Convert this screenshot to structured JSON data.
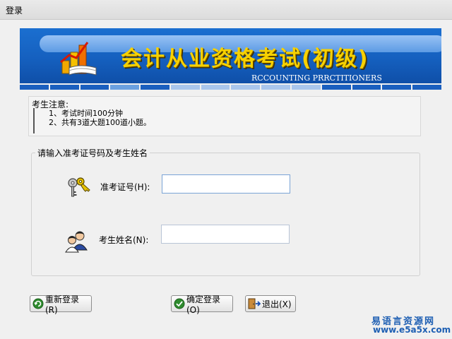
{
  "window": {
    "title": "登录"
  },
  "banner": {
    "title": "会计从业资格考试(初级)",
    "subtitle": "RCCOUNTING PRRCTITIONERS"
  },
  "notice": {
    "heading": "考生注意:",
    "lines": [
      "1、考试时间100分钟",
      "2、共有3道大题100道小题。"
    ]
  },
  "form": {
    "group_label": "请输入准考证号码及考生姓名",
    "exam_id_label": "准考证号(H):",
    "exam_id_value": "",
    "name_label": "考生姓名(N):",
    "name_value": ""
  },
  "buttons": {
    "relogin": "重新登录(R)",
    "confirm": "确定登录(O)",
    "exit": "退出(X)"
  },
  "watermark": {
    "line1": "易语言资源网",
    "line2": "www.e5a5x.com"
  },
  "colors": {
    "banner_blue": "#1560bf",
    "title_yellow": "#f7d100",
    "watermark_blue": "#1e5fb3"
  }
}
